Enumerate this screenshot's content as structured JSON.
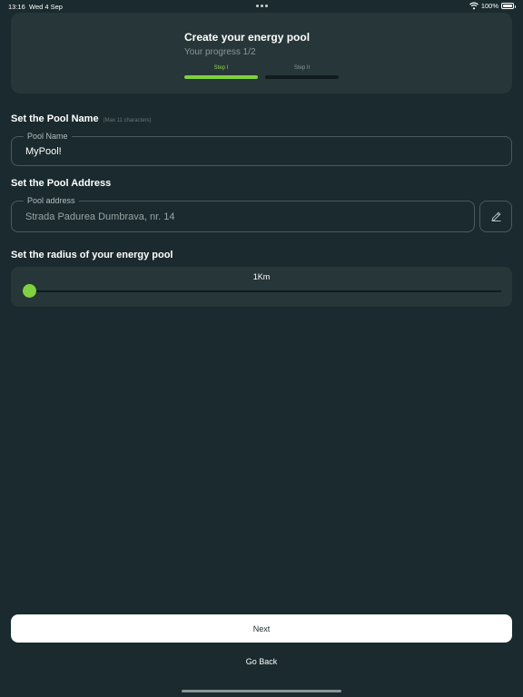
{
  "status_bar": {
    "time": "13:16",
    "date": "Wed 4 Sep",
    "battery": "100%"
  },
  "header": {
    "title": "Create your energy pool",
    "progress": "Your progress 1/2",
    "steps": [
      {
        "label": "Step I",
        "active": true
      },
      {
        "label": "Step II",
        "active": false
      }
    ]
  },
  "pool_name": {
    "section_title": "Set the Pool Name",
    "hint": "(Max 11 characters)",
    "field_label": "Pool Name",
    "value": "MyPool!"
  },
  "pool_address": {
    "section_title": "Set the Pool Address",
    "field_label": "Pool address",
    "value": "Strada Padurea Dumbrava, nr. 14",
    "edit_icon": "pencil-icon"
  },
  "radius": {
    "section_title": "Set the radius of your energy pool",
    "value_label": "1Km",
    "slider_fraction": 0
  },
  "actions": {
    "next_label": "Next",
    "back_label": "Go Back"
  },
  "colors": {
    "background": "#1a2a2e",
    "card": "#273638",
    "accent": "#7fd13f"
  }
}
